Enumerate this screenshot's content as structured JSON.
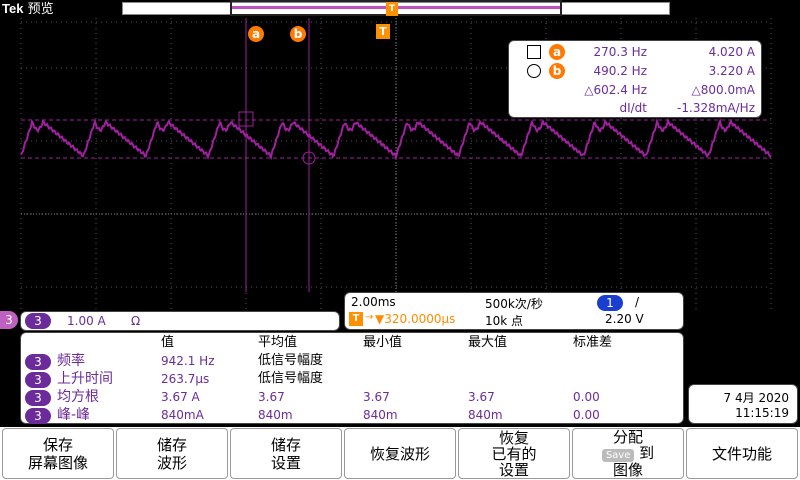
{
  "header": {
    "brand": "Tek",
    "mode": "预览"
  },
  "colors": {
    "trace": "#a020a0",
    "cursor": "#a020a0",
    "accent": "#ff7a00",
    "channel": "#6b2b9a"
  },
  "markers": {
    "a": "a",
    "b": "b",
    "t": "T"
  },
  "cursor_readout": {
    "a": {
      "freq": "270.3 Hz",
      "amp": "4.020 A"
    },
    "b": {
      "freq": "490.2 Hz",
      "amp": "3.220 A"
    },
    "delta": {
      "freq": "△602.4 Hz",
      "amp": "△800.0mA"
    },
    "slope": {
      "label": "dI/dt",
      "value": "-1.328mA/Hz"
    }
  },
  "timebase": {
    "scale": "2.00ms",
    "sample_rate": "500k次/秒",
    "trigger_position": "▼320.0000µs",
    "record_length": "10k 点",
    "trigger_channel": "1",
    "trigger_slope": "/",
    "trigger_level": "2.20 V"
  },
  "channel": {
    "number": "3",
    "scale": "1.00 A",
    "impedance": "Ω"
  },
  "measurements": {
    "headers": [
      "值",
      "平均值",
      "最小值",
      "最大值",
      "标准差"
    ],
    "rows": [
      {
        "ch": "3",
        "name": "频率",
        "value": "942.1 Hz",
        "mean": "低信号幅度",
        "min": "",
        "max": "",
        "std": ""
      },
      {
        "ch": "3",
        "name": "上升时间",
        "value": "263.7µs",
        "mean": "低信号幅度",
        "min": "",
        "max": "",
        "std": ""
      },
      {
        "ch": "3",
        "name": "均方根",
        "value": "3.67 A",
        "mean": "3.67",
        "min": "3.67",
        "max": "3.67",
        "std": "0.00"
      },
      {
        "ch": "3",
        "name": "峰-峰",
        "value": "840mA",
        "mean": "840m",
        "min": "840m",
        "max": "840m",
        "std": "0.00"
      }
    ]
  },
  "datetime": {
    "date": "7 4月 2020",
    "time": "11:15:19"
  },
  "menu": [
    {
      "line1": "保存",
      "line2": "屏幕图像"
    },
    {
      "line1": "储存",
      "line2": "波形"
    },
    {
      "line1": "储存",
      "line2": "设置"
    },
    {
      "line1": "恢复波形",
      "line2": ""
    },
    {
      "line1": "恢复",
      "line2": "已有的",
      "line3": "设置"
    },
    {
      "line1": "分配",
      "pill": "Save",
      "line2": "到",
      "line3": "图像"
    },
    {
      "line1": "文件功能",
      "line2": ""
    }
  ]
}
